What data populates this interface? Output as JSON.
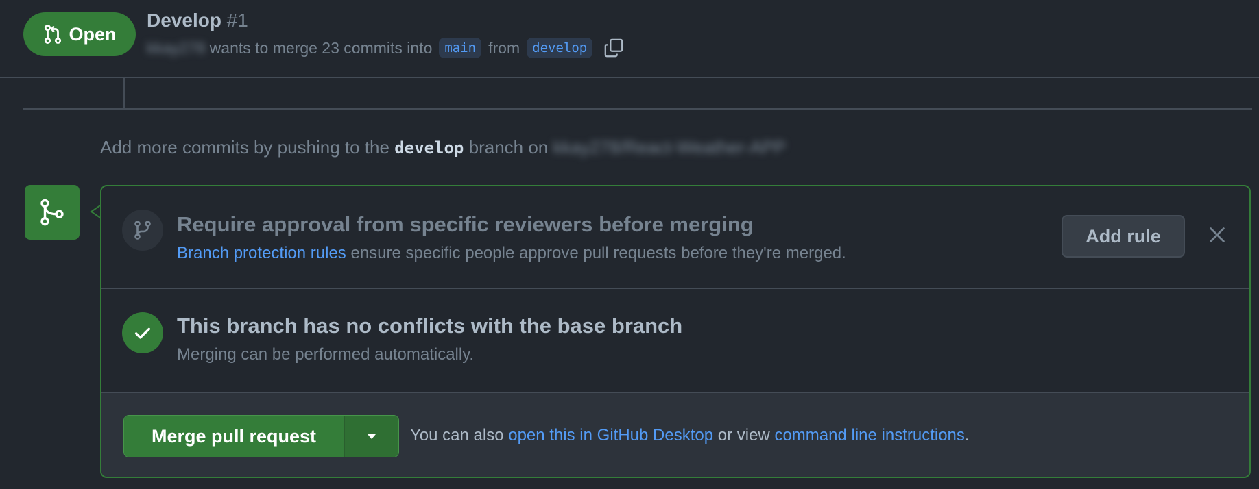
{
  "header": {
    "status_label": "Open",
    "title": "Develop",
    "number": "#1",
    "author": "kkay278",
    "meta_text": "wants to merge 23 commits into",
    "base_branch": "main",
    "from_text": "from",
    "head_branch": "develop"
  },
  "push_notice": {
    "prefix": "Add more commits by pushing to the",
    "branch": "develop",
    "middle": "branch on",
    "repo": "kkay278/React-Weather-APP"
  },
  "protection": {
    "title": "Require approval from specific reviewers before merging",
    "link_text": "Branch protection rules",
    "desc": "ensure specific people approve pull requests before they're merged.",
    "button": "Add rule"
  },
  "conflicts": {
    "title": "This branch has no conflicts with the base branch",
    "desc": "Merging can be performed automatically."
  },
  "merge": {
    "button": "Merge pull request",
    "also_prefix": "You can also",
    "desktop_link": "open this in GitHub Desktop",
    "or_view": "or view",
    "cli_link": "command line instructions",
    "suffix": "."
  },
  "colors": {
    "background": "#22272e",
    "accent_green": "#347d39",
    "link_blue": "#539bf5",
    "border": "#444c56"
  },
  "icons": {
    "status": "git-pull-request-icon",
    "copy": "copy-icon",
    "merge": "git-merge-icon",
    "branch": "git-branch-icon",
    "check": "check-icon",
    "close": "close-icon",
    "dropdown": "triangle-down-icon"
  }
}
